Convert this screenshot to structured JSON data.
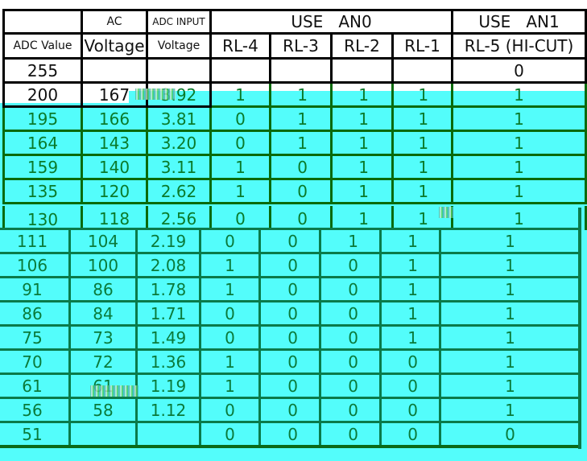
{
  "header": {
    "row1": {
      "blank": "",
      "ac": "AC",
      "adc_input": "ADC INPUT",
      "use_an0": "USE   AN0",
      "use_an1": "USE   AN1"
    },
    "row2": {
      "adc_value": "ADC Value",
      "ac_voltage": "Voltage",
      "adc_voltage": "Voltage",
      "rl4": "RL-4",
      "rl3": "RL-3",
      "rl2": "RL-2",
      "rl1": "RL-1",
      "rl5": "RL-5 (HI-CUT)"
    }
  },
  "rows": [
    {
      "adc": "255",
      "ac": "",
      "vin": "",
      "rl4": "",
      "rl3": "",
      "rl2": "",
      "rl1": "",
      "rl5": "0"
    },
    {
      "adc": "200",
      "ac": "167",
      "vin": "3.92",
      "rl4": "1",
      "rl3": "1",
      "rl2": "1",
      "rl1": "1",
      "rl5": "1"
    },
    {
      "adc": "195",
      "ac": "166",
      "vin": "3.81",
      "rl4": "0",
      "rl3": "1",
      "rl2": "1",
      "rl1": "1",
      "rl5": "1"
    },
    {
      "adc": "164",
      "ac": "143",
      "vin": "3.20",
      "rl4": "0",
      "rl3": "1",
      "rl2": "1",
      "rl1": "1",
      "rl5": "1"
    },
    {
      "adc": "159",
      "ac": "140",
      "vin": "3.11",
      "rl4": "1",
      "rl3": "0",
      "rl2": "1",
      "rl1": "1",
      "rl5": "1"
    },
    {
      "adc": "135",
      "ac": "120",
      "vin": "2.62",
      "rl4": "1",
      "rl3": "0",
      "rl2": "1",
      "rl1": "1",
      "rl5": "1"
    },
    {
      "adc": "130",
      "ac": "118",
      "vin": "2.56",
      "rl4": "0",
      "rl3": "0",
      "rl2": "1",
      "rl1": "1",
      "rl5": "1"
    },
    {
      "adc": "111",
      "ac": "104",
      "vin": "2.19",
      "rl4": "0",
      "rl3": "0",
      "rl2": "1",
      "rl1": "1",
      "rl5": "1"
    },
    {
      "adc": "106",
      "ac": "100",
      "vin": "2.08",
      "rl4": "1",
      "rl3": "0",
      "rl2": "0",
      "rl1": "1",
      "rl5": "1"
    },
    {
      "adc": "91",
      "ac": "86",
      "vin": "1.78",
      "rl4": "1",
      "rl3": "0",
      "rl2": "0",
      "rl1": "1",
      "rl5": "1"
    },
    {
      "adc": "86",
      "ac": "84",
      "vin": "1.71",
      "rl4": "0",
      "rl3": "0",
      "rl2": "0",
      "rl1": "1",
      "rl5": "1"
    },
    {
      "adc": "75",
      "ac": "73",
      "vin": "1.49",
      "rl4": "0",
      "rl3": "0",
      "rl2": "0",
      "rl1": "1",
      "rl5": "1"
    },
    {
      "adc": "70",
      "ac": "72",
      "vin": "1.36",
      "rl4": "1",
      "rl3": "0",
      "rl2": "0",
      "rl1": "0",
      "rl5": "1"
    },
    {
      "adc": "61",
      "ac": "61",
      "vin": "1.19",
      "rl4": "1",
      "rl3": "0",
      "rl2": "0",
      "rl1": "0",
      "rl5": "1"
    },
    {
      "adc": "56",
      "ac": "58",
      "vin": "1.12",
      "rl4": "0",
      "rl3": "0",
      "rl2": "0",
      "rl1": "0",
      "rl5": "1"
    },
    {
      "adc": "51",
      "ac": "",
      "vin": "",
      "rl4": "0",
      "rl3": "0",
      "rl2": "0",
      "rl1": "0",
      "rl5": "0"
    }
  ],
  "colors": {
    "highlight": "#53fdfb",
    "border_dark": "#000000",
    "border_green": "#0a7a4a",
    "text_green": "#0a7a3a"
  }
}
